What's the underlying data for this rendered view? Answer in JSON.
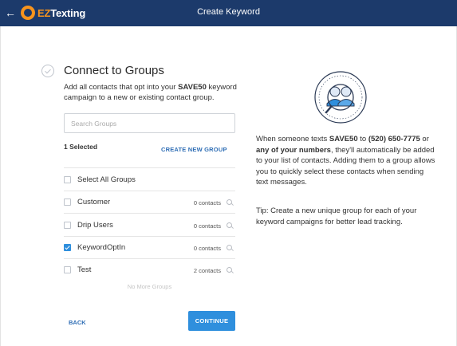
{
  "topbar": {
    "back_icon": "arrow-left-icon",
    "logo": {
      "part1": "EZ",
      "part2": "Texting"
    },
    "title": "Create Keyword",
    "bg_color": "#1c3a6b",
    "logo_color": "#f7941d"
  },
  "step": {
    "heading": "Connect to Groups",
    "desc_before": "Add all contacts that opt into your ",
    "keyword": "SAVE50",
    "desc_after": " keyword campaign to a new or existing contact group."
  },
  "search": {
    "placeholder": "Search Groups",
    "value": ""
  },
  "selected_count": "1 Selected",
  "create_group_label": "CREATE NEW GROUP",
  "groups": [
    {
      "label": "Select All Groups",
      "checked": false,
      "count": ""
    },
    {
      "label": "Customer",
      "checked": false,
      "count": "0 contacts"
    },
    {
      "label": "Drip Users",
      "checked": false,
      "count": "0 contacts"
    },
    {
      "label": "KeywordOptIn",
      "checked": true,
      "count": "0 contacts"
    },
    {
      "label": "Test",
      "checked": false,
      "count": "2 contacts"
    }
  ],
  "no_more_groups": "No More Groups",
  "actions": {
    "back": "BACK",
    "continue": "CONTINUE",
    "accent_color": "#2f8fdd"
  },
  "info": {
    "part1": "When someone texts ",
    "keyword": "SAVE50",
    "part2": " to ",
    "phone": "(520) 650-7775",
    "part3": " or ",
    "numbers": "any of your numbers",
    "part4": ", they'll automatically be added to your list of contacts. Adding them to a group allows you to quickly select these contacts when sending text messages."
  },
  "tip": "Tip: Create a new unique group for each of your keyword campaigns for better lead tracking."
}
